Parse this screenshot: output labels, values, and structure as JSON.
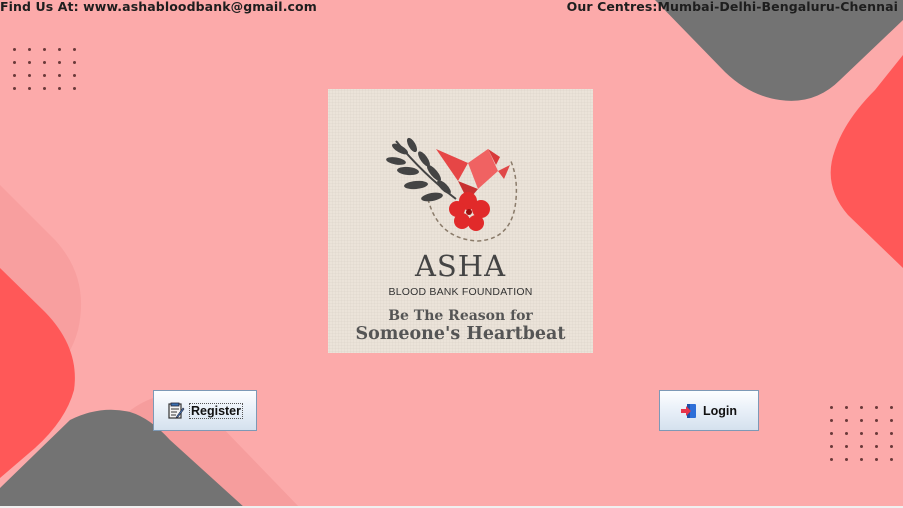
{
  "header": {
    "contact": "Find Us At: www.ashabloodbank@gmail.com",
    "centres": "Our Centres:Mumbai-Delhi-Bengaluru-Chennai"
  },
  "logo": {
    "name": "ASHA",
    "subtitle": "BLOOD BANK FOUNDATION",
    "tagline_1": "Be The Reason for",
    "tagline_2": "Someone's Heartbeat"
  },
  "buttons": {
    "register": "Register",
    "login": "Login"
  },
  "icons": {
    "register": "register-form-icon",
    "login": "login-icon"
  },
  "colors": {
    "background": "#fcaaaa",
    "accent_red": "#ff5858",
    "accent_gray": "#737373"
  }
}
